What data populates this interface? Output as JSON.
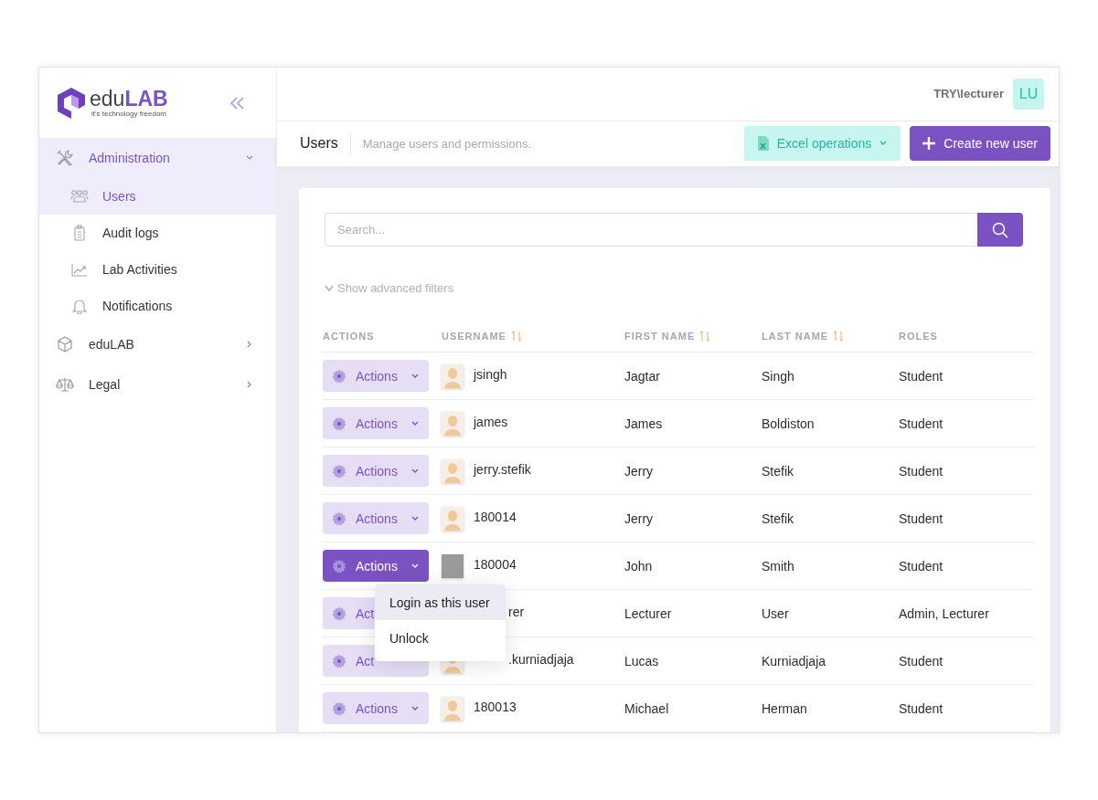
{
  "logo": {
    "wordmark": "edu**LAB**",
    "tagline": "it's technology freedom"
  },
  "sidebar": {
    "items": [
      {
        "label": "Administration",
        "expanded": true,
        "selected": true,
        "children": [
          {
            "label": "Users",
            "selected": true
          },
          {
            "label": "Audit logs",
            "selected": false
          },
          {
            "label": "Lab Activities",
            "selected": false
          },
          {
            "label": "Notifications",
            "selected": false
          }
        ]
      },
      {
        "label": "eduLAB",
        "expanded": false,
        "selected": false
      },
      {
        "label": "Legal",
        "expanded": false,
        "selected": false
      }
    ]
  },
  "header": {
    "account": "TRY\\lecturer",
    "avatar_initials": "LU"
  },
  "page": {
    "title": "Users",
    "subtitle": "Manage users and permissions.",
    "excel_button": "Excel operations",
    "create_button": "Create new user"
  },
  "search": {
    "placeholder": "Search..."
  },
  "advanced_filters": "Show advanced filters",
  "table": {
    "columns": [
      {
        "label": "ACTIONS",
        "kind": "plain"
      },
      {
        "label": "USERNAME",
        "kind": "sortable"
      },
      {
        "label": "FIRST NAME",
        "kind": "sortable"
      },
      {
        "label": "LAST NAME",
        "kind": "sortable"
      },
      {
        "label": "ROLES",
        "kind": "plain"
      }
    ],
    "rows": [
      {
        "kind": "default",
        "action": "Actions",
        "selected": false,
        "username": "jsingh",
        "first": "Jagtar",
        "last": "Singh",
        "roles": "Student"
      },
      {
        "kind": "default",
        "action": "Actions",
        "selected": false,
        "username": "james",
        "first": "James",
        "last": "Boldiston",
        "roles": "Student"
      },
      {
        "kind": "default",
        "action": "Actions",
        "selected": false,
        "username": "jerry.stefik",
        "first": "Jerry",
        "last": "Stefik",
        "roles": "Student"
      },
      {
        "kind": "default",
        "action": "Actions",
        "selected": false,
        "username": "180014",
        "first": "Jerry",
        "last": "Stefik",
        "roles": "Student"
      },
      {
        "kind": "photo",
        "action": "Actions",
        "selected": true,
        "username": "180004",
        "first": "John",
        "last": "Smith",
        "roles": "Student"
      },
      {
        "kind": "covered",
        "action": "Act",
        "selected": false,
        "username": "rer",
        "first": "Lecturer",
        "last": "User",
        "roles": "Admin, Lecturer"
      },
      {
        "kind": "covered_avatar",
        "action": "Act",
        "selected": false,
        "username": ".kurniadjaja",
        "first": "Lucas",
        "last": "Kurniadjaja",
        "roles": "Student"
      },
      {
        "kind": "default",
        "action": "Actions",
        "selected": false,
        "username": "180013",
        "first": "Michael",
        "last": "Herman",
        "roles": "Student"
      }
    ]
  },
  "action_menu": {
    "items": [
      {
        "label": "Login as this user",
        "selected": true
      },
      {
        "label": "Unlock",
        "selected": false
      }
    ]
  }
}
